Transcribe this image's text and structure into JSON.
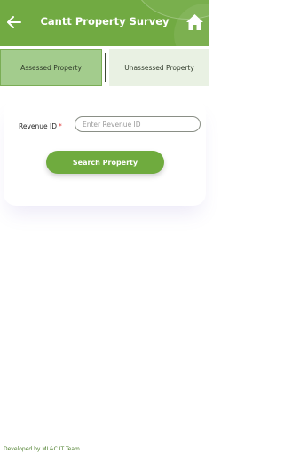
{
  "header": {
    "title": "Cantt Property Survey",
    "back_icon": "arrow-left-icon",
    "home_icon": "home-icon",
    "background_color": "#71aa42"
  },
  "tabs": [
    {
      "label": "Assessed Property",
      "selected": true
    },
    {
      "label": "Unassessed Property",
      "selected": false
    }
  ],
  "form": {
    "revenue_label": "Revenue ID",
    "required_marker": "*",
    "revenue_input": {
      "value": "",
      "placeholder": "Enter Revenue ID"
    },
    "search_button": "Search Property"
  },
  "footer": {
    "text": "Developed by ML&C IT Team"
  }
}
